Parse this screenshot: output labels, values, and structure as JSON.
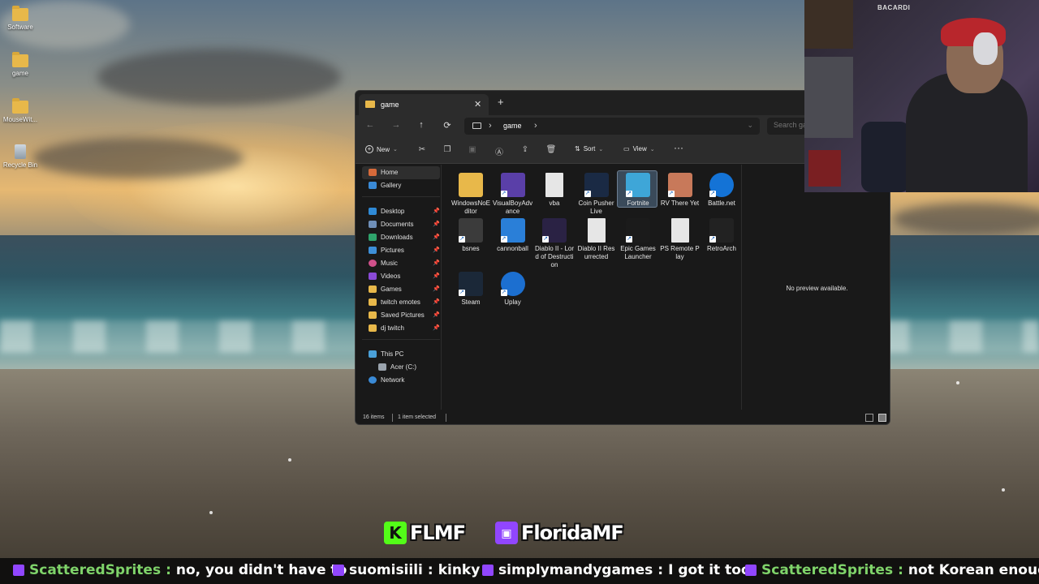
{
  "desktop": {
    "icons": [
      {
        "label": "Software",
        "icon": "folder-icon"
      },
      {
        "label": "game",
        "icon": "folder-icon"
      },
      {
        "label": "MouseWit...",
        "icon": "folder-icon"
      },
      {
        "label": "Recycle Bin",
        "icon": "recycle-bin-icon"
      }
    ]
  },
  "explorer": {
    "tab_title": "game",
    "tab_close": "✕",
    "tab_add": "+",
    "address": {
      "crumb_sep": "›",
      "current": "game",
      "search_placeholder": "Search game"
    },
    "toolbar": {
      "new_label": "New",
      "sort_label": "Sort",
      "view_label": "View",
      "more_label": "···"
    },
    "nav": {
      "home": "Home",
      "gallery": "Gallery",
      "pinned": [
        "Desktop",
        "Documents",
        "Downloads",
        "Pictures",
        "Music",
        "Videos",
        "Games",
        "twitch emotes",
        "Saved Pictures",
        "dj twitch"
      ],
      "this_pc": "This PC",
      "drive": "Acer (C:)",
      "network": "Network"
    },
    "files": [
      {
        "label": "WindowsNoEditor",
        "icon": "folder-icon",
        "color": "#e8b84a"
      },
      {
        "label": "VisualBoyAdvance",
        "icon": "gba-icon",
        "color": "#5a3fa8"
      },
      {
        "label": "vba",
        "icon": "config-file-icon",
        "color": "#e6e6e6"
      },
      {
        "label": "Coin Pusher Live",
        "icon": "coin-pusher-icon",
        "color": "#1a2a44"
      },
      {
        "label": "Fortnite",
        "icon": "fortnite-icon",
        "color": "#3ea6d8"
      },
      {
        "label": "RV There Yet",
        "icon": "rv-there-yet-icon",
        "color": "#c8795a"
      },
      {
        "label": "Battle.net",
        "icon": "battlenet-icon",
        "color": "#1473d6"
      },
      {
        "label": "bsnes",
        "icon": "snes-icon",
        "color": "#3b3b3b"
      },
      {
        "label": "cannonball",
        "icon": "cannonball-icon",
        "color": "#2a7fd8"
      },
      {
        "label": "Diablo II - Lord of Destruction",
        "icon": "diablo-icon",
        "color": "#2a2244"
      },
      {
        "label": "Diablo II Resurrected",
        "icon": "blank-file-icon",
        "color": "#e6e6e6"
      },
      {
        "label": "Epic Games Launcher",
        "icon": "epic-games-icon",
        "color": "#1b1b1b"
      },
      {
        "label": "PS Remote Play",
        "icon": "blank-file-icon",
        "color": "#e6e6e6"
      },
      {
        "label": "RetroArch",
        "icon": "retroarch-icon",
        "color": "#222"
      },
      {
        "label": "Steam",
        "icon": "steam-icon",
        "color": "#1b2838"
      },
      {
        "label": "Uplay",
        "icon": "uplay-icon",
        "color": "#1c6fd0"
      }
    ],
    "selected_file": "Fortnite",
    "preview_text": "No preview available.",
    "status": {
      "items": "16 items",
      "selection": "1 item selected"
    }
  },
  "webcam": {
    "bottle_label": "BACARDI"
  },
  "overlay": {
    "kick_handle": "FLMF",
    "kick_letter": "K",
    "twitch_handle": "FloridaMF"
  },
  "chat": [
    {
      "user": "ScatteredSprites",
      "text": "no, you didn't have to"
    },
    {
      "user": "suomisiili",
      "text": "kinky"
    },
    {
      "user": "simplymandygames",
      "text": "I got it too"
    },
    {
      "user": "ScatteredSprites",
      "text": "not Korean enough"
    }
  ]
}
